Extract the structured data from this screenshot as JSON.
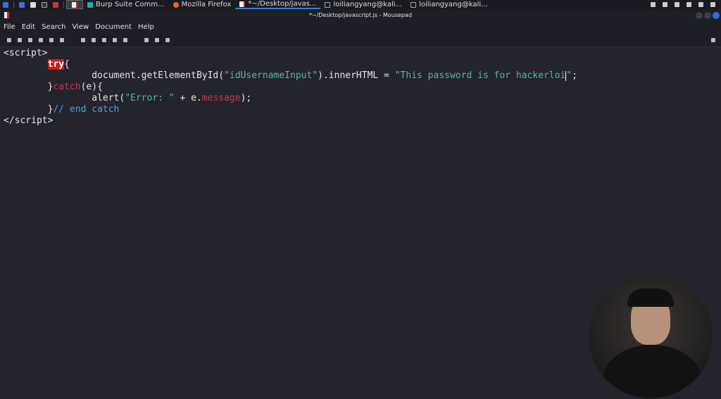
{
  "taskbar": {
    "tasks": [
      {
        "label": "Burp Suite Comm..."
      },
      {
        "label": "Mozilla Firefox"
      },
      {
        "label": "*~/Desktop/javas..."
      },
      {
        "label": "loiliangyang@kali..."
      },
      {
        "label": "loiliangyang@kali..."
      }
    ]
  },
  "window": {
    "title": "*~/Desktop/javascript.js - Mousepad"
  },
  "menu": [
    "File",
    "Edit",
    "Search",
    "View",
    "Document",
    "Help"
  ],
  "code": {
    "l1": "<script>",
    "try": "try",
    "brace_open": "{",
    "l3_a": "document.getElementById(",
    "l3_s1": "\"idUsernameInput\"",
    "l3_b": ").innerHTML = ",
    "l3_s2": "\"This password is for hackerloi",
    "l3_s3": "\"",
    "l3_c": ";",
    "close_brace": "}",
    "catch": "catch",
    "catch_args": "(e){",
    "l5_a": "alert(",
    "l5_s": "\"Error: \"",
    "l5_b": " + e.",
    "l5_m": "message",
    "l5_c": ");",
    "comment": "// end catch",
    "l7": "</script>"
  }
}
